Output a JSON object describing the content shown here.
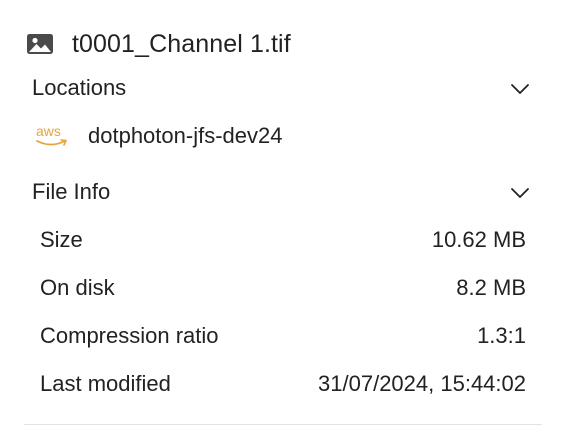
{
  "file": {
    "name": "t0001_Channel 1.tif",
    "icon": "image-icon"
  },
  "locations": {
    "title": "Locations",
    "items": [
      {
        "provider": "aws",
        "logo_text": "aws",
        "name": "dotphoton-jfs-dev24"
      }
    ]
  },
  "file_info": {
    "title": "File Info",
    "rows": [
      {
        "label": "Size",
        "value": "10.62 MB"
      },
      {
        "label": "On disk",
        "value": "8.2 MB"
      },
      {
        "label": "Compression ratio",
        "value": "1.3:1"
      },
      {
        "label": "Last modified",
        "value": "31/07/2024, 15:44:02"
      }
    ]
  },
  "colors": {
    "aws_logo": "#e8a33d",
    "text": "#222222",
    "divider": "#e3e3e3"
  }
}
